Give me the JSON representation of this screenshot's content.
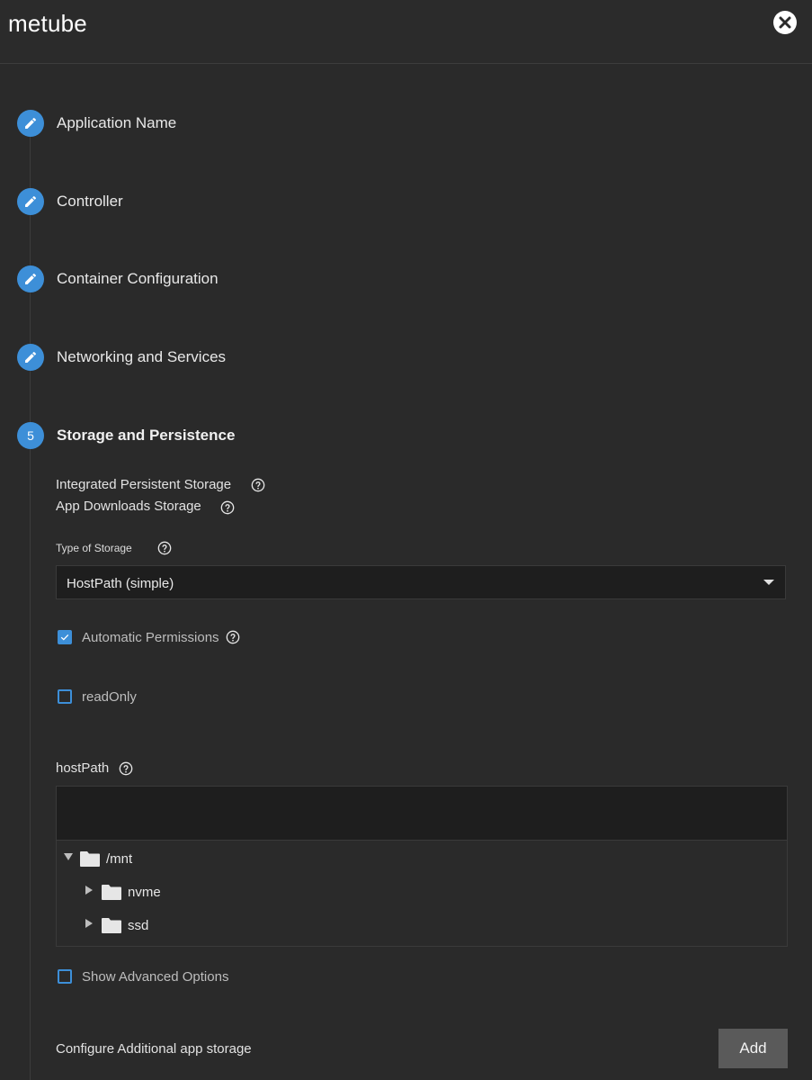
{
  "header": {
    "title": "metube",
    "close_icon": "close-circle-icon"
  },
  "steps": [
    {
      "label": "Application Name",
      "icon": "pencil-icon"
    },
    {
      "label": "Controller",
      "icon": "pencil-icon"
    },
    {
      "label": "Container Configuration",
      "icon": "pencil-icon"
    },
    {
      "label": "Networking and Services",
      "icon": "pencil-icon"
    },
    {
      "label": "Storage and Persistence",
      "number": "5"
    }
  ],
  "storage": {
    "integrated_label": "Integrated Persistent Storage",
    "downloads_label": "App Downloads Storage",
    "type_label": "Type of Storage",
    "type_value": "HostPath (simple)",
    "auto_permissions_label": "Automatic Permissions",
    "auto_permissions_checked": true,
    "readonly_label": "readOnly",
    "readonly_checked": false,
    "hostpath_label": "hostPath",
    "hostpath_value": "",
    "tree": [
      {
        "label": "/mnt",
        "expanded": true
      },
      {
        "label": "nvme",
        "expanded": false
      },
      {
        "label": "ssd",
        "expanded": false
      }
    ],
    "advanced_label": "Show Advanced Options",
    "advanced_checked": false,
    "additional_label": "Configure Additional app storage",
    "add_label": "Add"
  },
  "colors": {
    "accent": "#3d8fd8",
    "background": "#2a2a2a",
    "input_bg": "#1e1e1e"
  }
}
